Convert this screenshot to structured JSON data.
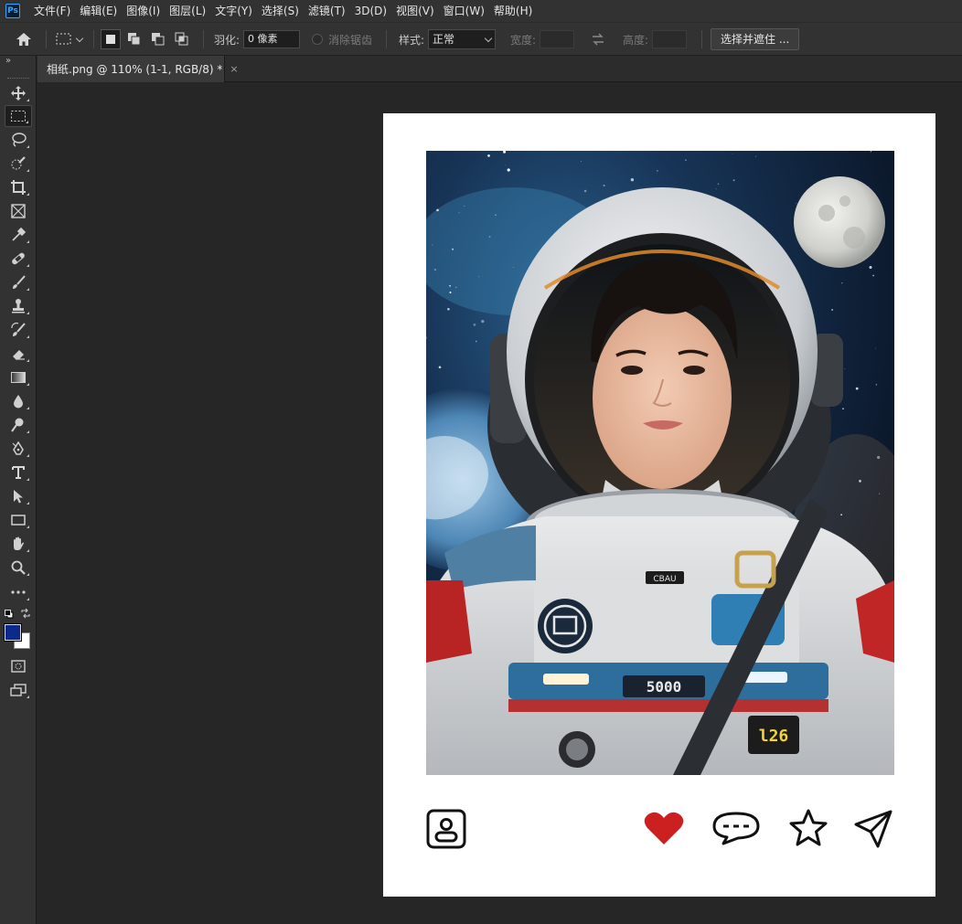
{
  "app": {
    "logo_text": "Ps"
  },
  "menu": [
    "文件(F)",
    "编辑(E)",
    "图像(I)",
    "图层(L)",
    "文字(Y)",
    "选择(S)",
    "滤镜(T)",
    "3D(D)",
    "视图(V)",
    "窗口(W)",
    "帮助(H)"
  ],
  "options": {
    "feather_label": "羽化:",
    "feather_value": "0 像素",
    "antialias_label": "消除锯齿",
    "style_label": "样式:",
    "style_value": "正常",
    "width_label": "宽度:",
    "height_label": "高度:",
    "select_mask_button": "选择并遮住 ..."
  },
  "document": {
    "tab_label": "相纸.png @ 110% (1-1, RGB/8) *",
    "close_glyph": "×"
  },
  "photo": {
    "chest_patch_text": "5000",
    "badge_text": "l26",
    "collar_text": "CBAU"
  },
  "colors": {
    "foreground": "#0b2a8c",
    "background": "#ffffff",
    "heart": "#cc1f1f",
    "photoshop_blue": "#31a8ff"
  },
  "tools": [
    "move-tool",
    "rectangular-marquee-tool",
    "lasso-tool",
    "quick-selection-tool",
    "crop-tool",
    "frame-tool",
    "eyedropper-tool",
    "healing-brush-tool",
    "brush-tool",
    "clone-stamp-tool",
    "history-brush-tool",
    "eraser-tool",
    "gradient-tool",
    "blur-tool",
    "dodge-tool",
    "pen-tool",
    "type-tool",
    "path-selection-tool",
    "rectangle-tool",
    "hand-tool",
    "zoom-tool",
    "edit-toolbar",
    "quick-mask",
    "screen-mode"
  ],
  "actions": [
    "profile-icon",
    "heart-icon",
    "comment-icon",
    "star-icon",
    "send-icon"
  ]
}
